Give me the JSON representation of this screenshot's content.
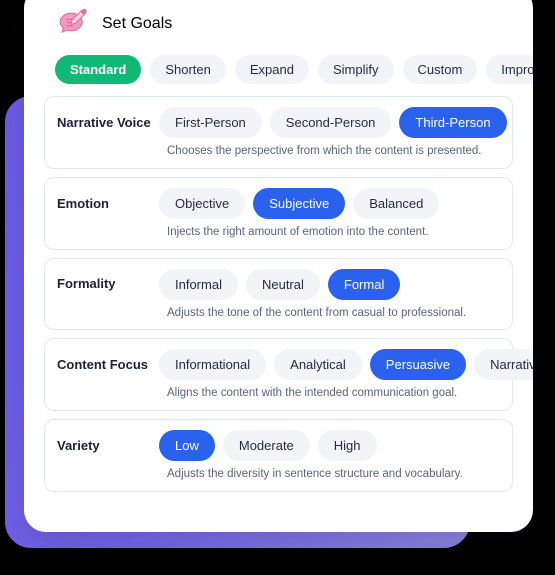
{
  "header": {
    "title": "Set Goals",
    "icon": "chat-bubble-pencil-icon"
  },
  "colors": {
    "accent_green": "#13B876",
    "accent_blue": "#2A62EE",
    "pill_bg": "#F2F4F8",
    "card_shadow_purple": "#6C5CE7",
    "text_dark": "#1B2138",
    "text_muted": "#5A6478",
    "border": "#E3E8F0",
    "page_bg": "#000000"
  },
  "mode_tabs": [
    {
      "label": "Standard",
      "active": true
    },
    {
      "label": "Shorten",
      "active": false
    },
    {
      "label": "Expand",
      "active": false
    },
    {
      "label": "Simplify",
      "active": false
    },
    {
      "label": "Custom",
      "active": false
    },
    {
      "label": "Improve Writing",
      "active": false
    }
  ],
  "settings": [
    {
      "label": "Narrative Voice",
      "description": "Chooses the perspective from which the content is presented.",
      "options": [
        {
          "label": "First-Person",
          "selected": false
        },
        {
          "label": "Second-Person",
          "selected": false
        },
        {
          "label": "Third-Person",
          "selected": true
        }
      ]
    },
    {
      "label": "Emotion",
      "description": "Injects the right amount of emotion into the content.",
      "options": [
        {
          "label": "Objective",
          "selected": false
        },
        {
          "label": "Subjective",
          "selected": true
        },
        {
          "label": "Balanced",
          "selected": false
        }
      ]
    },
    {
      "label": "Formality",
      "description": "Adjusts the tone of the content from casual to professional.",
      "options": [
        {
          "label": "Informal",
          "selected": false
        },
        {
          "label": "Neutral",
          "selected": false
        },
        {
          "label": "Formal",
          "selected": true
        }
      ]
    },
    {
      "label": "Content Focus",
      "description": "Aligns the content with the intended communication goal.",
      "options": [
        {
          "label": "Informational",
          "selected": false
        },
        {
          "label": "Analytical",
          "selected": false
        },
        {
          "label": "Persuasive",
          "selected": true
        },
        {
          "label": "Narrative",
          "selected": false
        }
      ]
    },
    {
      "label": "Variety",
      "description": "Adjusts the diversity in sentence structure and vocabulary.",
      "options": [
        {
          "label": "Low",
          "selected": true
        },
        {
          "label": "Moderate",
          "selected": false
        },
        {
          "label": "High",
          "selected": false
        }
      ]
    }
  ]
}
